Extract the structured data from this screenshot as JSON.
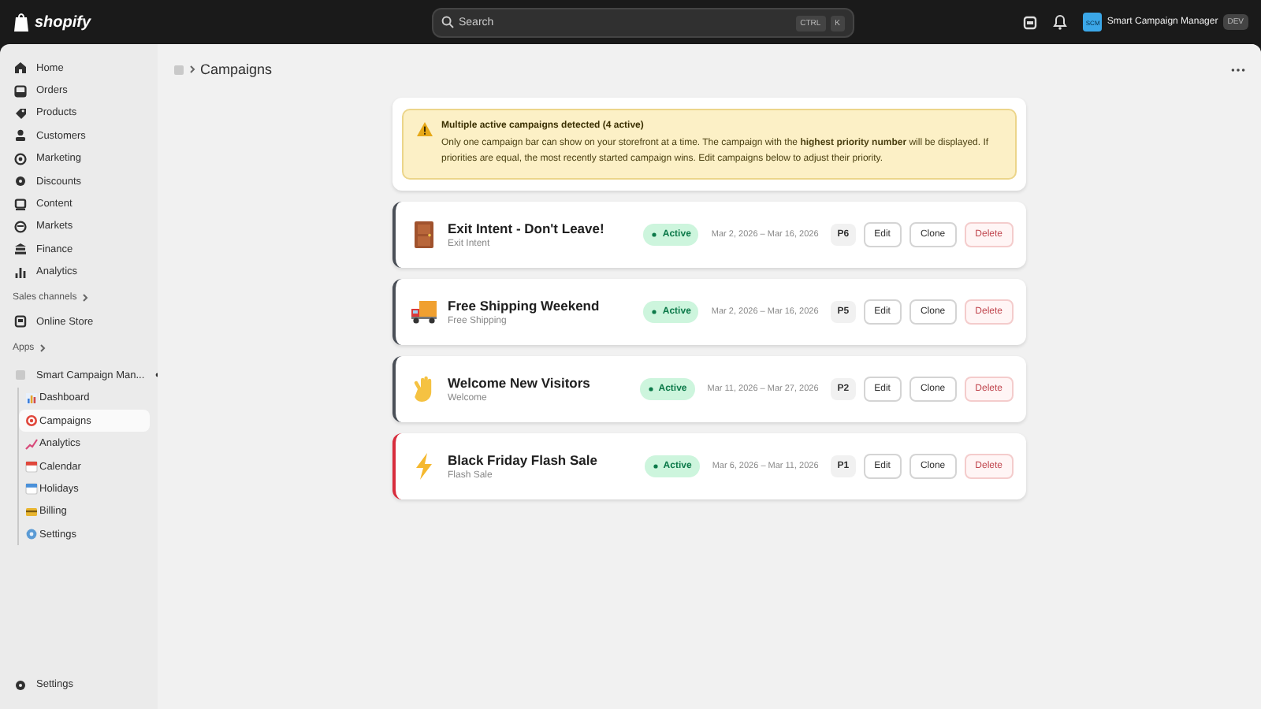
{
  "topbar": {
    "logo": "shopify",
    "search": {
      "placeholder": "Search"
    },
    "shortcut": [
      "CTRL",
      "K"
    ],
    "store": {
      "initials": "SCM",
      "name": "Smart Campaign Manager",
      "badge": "DEV"
    }
  },
  "sidebar": {
    "items": [
      {
        "label": "Home",
        "selected": false
      },
      {
        "label": "Orders",
        "selected": false
      },
      {
        "label": "Products",
        "selected": false
      },
      {
        "label": "Customers",
        "selected": false
      },
      {
        "label": "Marketing",
        "selected": false
      },
      {
        "label": "Discounts",
        "selected": false
      },
      {
        "label": "Content",
        "selected": false
      },
      {
        "label": "Markets",
        "selected": false
      },
      {
        "label": "Finance",
        "selected": false
      },
      {
        "label": "Analytics",
        "selected": false
      }
    ],
    "sales_channels": {
      "heading": "Sales channels",
      "items": [
        {
          "label": "Online Store"
        }
      ]
    },
    "apps": {
      "heading": "Apps",
      "app": {
        "label": "Smart Campaign Man...",
        "children": [
          {
            "label": "Dashboard",
            "selected": false
          },
          {
            "label": "Campaigns",
            "selected": true
          },
          {
            "label": "Analytics",
            "selected": false
          },
          {
            "label": "Calendar",
            "selected": false
          },
          {
            "label": "Holidays",
            "selected": false
          },
          {
            "label": "Billing",
            "selected": false
          },
          {
            "label": "Settings",
            "selected": false
          }
        ]
      }
    },
    "footer": {
      "label": "Settings"
    }
  },
  "page": {
    "breadcrumb": "Campaigns",
    "alert": {
      "title": "Multiple active campaigns detected (4 active)",
      "text": "Only one campaign bar can show on your storefront at a time. The campaign with the **highest priority number** will be displayed. If priorities are equal, the most recently started campaign wins. Edit campaigns below to adjust their priority."
    },
    "campaigns": [
      {
        "name": "Exit Intent - Don't Leave!",
        "type": "Exit Intent",
        "status": "Active",
        "dates": "Mar 2, 2026 – Mar 16, 2026",
        "priority": "P6",
        "color": "#4a4f57",
        "actions": [
          {
            "label": "Edit",
            "kind": "default"
          },
          {
            "label": "Clone",
            "kind": "default"
          },
          {
            "label": "Delete",
            "kind": "danger"
          }
        ]
      },
      {
        "name": "Free Shipping Weekend",
        "type": "Free Shipping",
        "status": "Active",
        "dates": "Mar 2, 2026 – Mar 16, 2026",
        "priority": "P5",
        "color": "#4a4f57",
        "actions": [
          {
            "label": "Edit",
            "kind": "default"
          },
          {
            "label": "Clone",
            "kind": "default"
          },
          {
            "label": "Delete",
            "kind": "danger"
          }
        ]
      },
      {
        "name": "Welcome New Visitors",
        "type": "Welcome",
        "status": "Active",
        "dates": "Mar 11, 2026 – Mar 27, 2026",
        "priority": "P2",
        "color": "#4a4f57",
        "actions": [
          {
            "label": "Edit",
            "kind": "default"
          },
          {
            "label": "Clone",
            "kind": "default"
          },
          {
            "label": "Delete",
            "kind": "danger"
          }
        ]
      },
      {
        "name": "Black Friday Flash Sale",
        "type": "Flash Sale",
        "status": "Active",
        "dates": "Mar 6, 2026 – Mar 11, 2026",
        "priority": "P1",
        "color": "#d82c3c",
        "actions": [
          {
            "label": "Edit",
            "kind": "default"
          },
          {
            "label": "Clone",
            "kind": "default"
          },
          {
            "label": "Delete",
            "kind": "danger"
          }
        ]
      }
    ]
  }
}
